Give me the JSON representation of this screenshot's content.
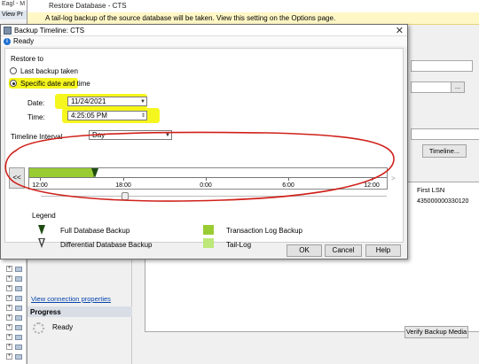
{
  "background": {
    "ssms_title": "Eagl - M",
    "ssms_menu": "View Pr",
    "restore_dialog": {
      "title": "Restore Database - CTS",
      "info_text": "A tail-log backup of the source database will be taken. View this setting on the Options page.",
      "view_connection_properties": "View connection properties",
      "progress_header": "Progress",
      "progress_status": "Ready",
      "timeline_button": "Timeline...",
      "grid_header_first_lsn": "First LSN",
      "grid_value_first_lsn": "435000000330120",
      "verify_button": "Verify Backup Media"
    }
  },
  "dialog": {
    "title": "Backup Timeline: CTS",
    "status": "Ready",
    "restore_to_label": "Restore to",
    "option_last": "Last backup taken",
    "option_specific": "Specific date and time",
    "date_label": "Date:",
    "date_value": "11/24/2021",
    "time_label": "Time:",
    "time_value": "4:25:05 PM",
    "interval_label": "Timeline Interval",
    "interval_value": "Day",
    "nav_prev": "<<",
    "nav_next": ">",
    "timeline_ticks": [
      "12:00",
      "18:00",
      "0:00",
      "6:00",
      "12:00"
    ],
    "legend_title": "Legend",
    "legend_full": "Full Database Backup",
    "legend_diff": "Differential Database Backup",
    "legend_tlog": "Transaction Log Backup",
    "legend_tail": "Tail-Log",
    "btn_ok": "OK",
    "btn_cancel": "Cancel",
    "btn_help": "Help"
  },
  "colors": {
    "tlog_green": "#99cc33",
    "tail_green": "#bde87a",
    "full_backup_marker": "#1f4c12",
    "highlight": "#f5f500",
    "annotation": "#d0201a"
  }
}
